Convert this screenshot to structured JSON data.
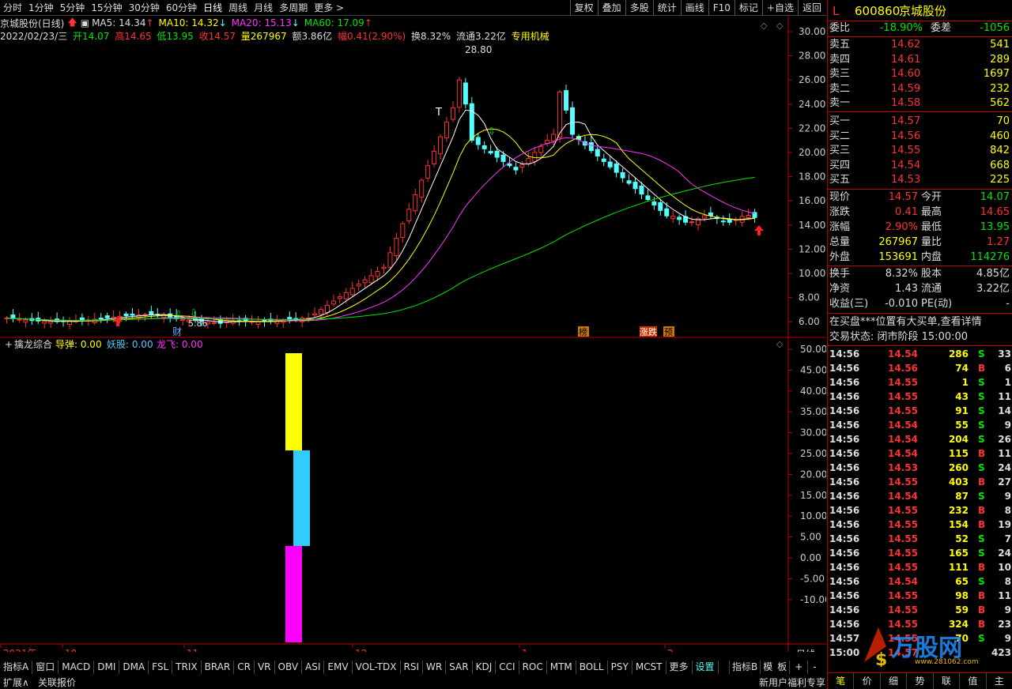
{
  "top_tabs": [
    "分时",
    "1分钟",
    "5分钟",
    "15分钟",
    "30分钟",
    "60分钟",
    "日线",
    "周线",
    "月线",
    "多周期",
    "更多 >"
  ],
  "active_tab": "日线",
  "top_buttons": [
    "复权",
    "叠加",
    "多股",
    "统计",
    "画线",
    "F10",
    "标记",
    "+自选",
    "返回"
  ],
  "ma_line": {
    "title": "京城股份(日线)",
    "ma5": "MA5: 14.34",
    "ma10": "MA10: 14.32",
    "ma20": "MA20: 15.13",
    "ma60": "MA60: 17.09"
  },
  "quote_line": {
    "date": "2022/02/23/三",
    "open": "开14.07",
    "high": "高14.65",
    "low": "低13.95",
    "close": "收14.57",
    "volume": "量267967",
    "amount": "额3.86亿",
    "amp": "幅0.41(2.90%)",
    "turnover": "换8.32%",
    "float": "流通3.22亿",
    "industry": "专用机械"
  },
  "price_axis": [
    "30.00",
    "28.00",
    "26.00",
    "24.00",
    "22.00",
    "20.00",
    "18.00",
    "16.00",
    "14.00",
    "12.00",
    "10.00",
    "8.00",
    "6.00"
  ],
  "indicator_axis": [
    "50.00",
    "45.00",
    "40.00",
    "35.00",
    "30.00",
    "25.00",
    "20.00",
    "15.00",
    "10.00",
    "5.00",
    "0.00",
    "-5.00",
    "-10.00"
  ],
  "chart_markers": {
    "peak": "28.80",
    "low": "5.86",
    "tag_cai": "财",
    "tag_bang": "榜",
    "tag_zhangdie": "涨跌",
    "tag_yu": "预",
    "tag_t": "T"
  },
  "indicator": {
    "name": "擒龙综合",
    "daotan": "导弹: 0.00",
    "yaogu": "妖股: 0.00",
    "longfei": "龙飞: 0.00"
  },
  "time_axis": [
    "2021年",
    "10",
    "11",
    "12",
    "1",
    "2"
  ],
  "time_axis_right": "日线",
  "bottom_tabs": [
    "指标A",
    "窗口",
    "MACD",
    "DMI",
    "DMA",
    "FSL",
    "TRIX",
    "BRAR",
    "CR",
    "VR",
    "OBV",
    "ASI",
    "EMV",
    "VOL-TDX",
    "RSI",
    "WR",
    "SAR",
    "KDJ",
    "CCI",
    "ROC",
    "MTM",
    "BOLL",
    "PSY",
    "MCST",
    "更多",
    "设置"
  ],
  "bottom_right": [
    "指标B",
    "模",
    "板"
  ],
  "status_bar": {
    "expand": "扩展∧",
    "related": "关联报价",
    "promo": "新用户福利专享"
  },
  "panel": {
    "mark": "L",
    "code": "600860",
    "name": "京城股份",
    "webi_label": "委比",
    "webi": "-18.90%",
    "weicha_label": "委差",
    "weicha": "-1056",
    "asks": [
      {
        "label": "卖五",
        "price": "14.62",
        "vol": "541"
      },
      {
        "label": "卖四",
        "price": "14.61",
        "vol": "289"
      },
      {
        "label": "卖三",
        "price": "14.60",
        "vol": "1697"
      },
      {
        "label": "卖二",
        "price": "14.59",
        "vol": "232"
      },
      {
        "label": "卖一",
        "price": "14.58",
        "vol": "562"
      }
    ],
    "bids": [
      {
        "label": "买一",
        "price": "14.57",
        "vol": "70"
      },
      {
        "label": "买二",
        "price": "14.56",
        "vol": "460"
      },
      {
        "label": "买三",
        "price": "14.55",
        "vol": "842"
      },
      {
        "label": "买四",
        "price": "14.54",
        "vol": "668"
      },
      {
        "label": "买五",
        "price": "14.53",
        "vol": "225"
      }
    ],
    "stats": [
      {
        "l1": "现价",
        "v1": "14.57",
        "l2": "今开",
        "v2": "14.07"
      },
      {
        "l1": "涨跌",
        "v1": "0.41",
        "l2": "最高",
        "v2": "14.65"
      },
      {
        "l1": "涨幅",
        "v1": "2.90%",
        "l2": "最低",
        "v2": "13.95"
      },
      {
        "l1": "总量",
        "v1": "267967",
        "l2": "量比",
        "v2": "1.27"
      },
      {
        "l1": "外盘",
        "v1": "153691",
        "l2": "内盘",
        "v2": "114276"
      }
    ],
    "stats2": [
      {
        "l1": "换手",
        "v1": "8.32%",
        "l2": "股本",
        "v2": "4.85亿"
      },
      {
        "l1": "净资",
        "v1": "1.43",
        "l2": "流通",
        "v2": "3.22亿"
      },
      {
        "l1": "收益(三)",
        "v1": "-0.010",
        "l2": "PE(动)",
        "v2": "-"
      }
    ],
    "notice": "在买盘***位置有大买单,查看详情",
    "trade_status": "交易状态: 闭市阶段 15:00:00",
    "ticks": [
      [
        "14:56",
        "14.54",
        "286",
        "S",
        "33"
      ],
      [
        "14:56",
        "14.56",
        "74",
        "B",
        "6"
      ],
      [
        "14:56",
        "14.55",
        "1",
        "S",
        "1"
      ],
      [
        "14:56",
        "14.55",
        "43",
        "S",
        "11"
      ],
      [
        "14:56",
        "14.55",
        "91",
        "S",
        "14"
      ],
      [
        "14:56",
        "14.54",
        "55",
        "S",
        "9"
      ],
      [
        "14:56",
        "14.54",
        "204",
        "S",
        "26"
      ],
      [
        "14:56",
        "14.54",
        "115",
        "B",
        "11"
      ],
      [
        "14:56",
        "14.53",
        "260",
        "S",
        "24"
      ],
      [
        "14:56",
        "14.55",
        "403",
        "B",
        "27"
      ],
      [
        "14:56",
        "14.54",
        "87",
        "S",
        "9"
      ],
      [
        "14:56",
        "14.55",
        "232",
        "B",
        "8"
      ],
      [
        "14:56",
        "14.55",
        "154",
        "B",
        "19"
      ],
      [
        "14:56",
        "14.55",
        "52",
        "S",
        "7"
      ],
      [
        "14:56",
        "14.55",
        "165",
        "S",
        "24"
      ],
      [
        "14:56",
        "14.55",
        "111",
        "B",
        "10"
      ],
      [
        "14:56",
        "14.54",
        "65",
        "S",
        "8"
      ],
      [
        "14:56",
        "14.55",
        "98",
        "B",
        "11"
      ],
      [
        "14:56",
        "14.55",
        "59",
        "B",
        "9"
      ],
      [
        "14:56",
        "14.55",
        "324",
        "B",
        "23"
      ],
      [
        "14:57",
        "14.55",
        "70",
        "S",
        "9"
      ],
      [
        "15:00",
        "14.57",
        "",
        "",
        "423"
      ]
    ],
    "bottom_tabs": [
      "笔",
      "价",
      "细",
      "势",
      "联",
      "值",
      "主"
    ],
    "watermark": "万股网",
    "watermark_url": "www.281062.com"
  },
  "colors": {
    "up": "#ff3232",
    "down": "#54ffff",
    "ma5": "#ffffff",
    "ma10": "#ffff00",
    "ma20": "#ff32ff",
    "ma60": "#00e600",
    "bar_yellow": "#ffff00",
    "bar_cyan": "#33ccff",
    "bar_magenta": "#ff00ff"
  }
}
